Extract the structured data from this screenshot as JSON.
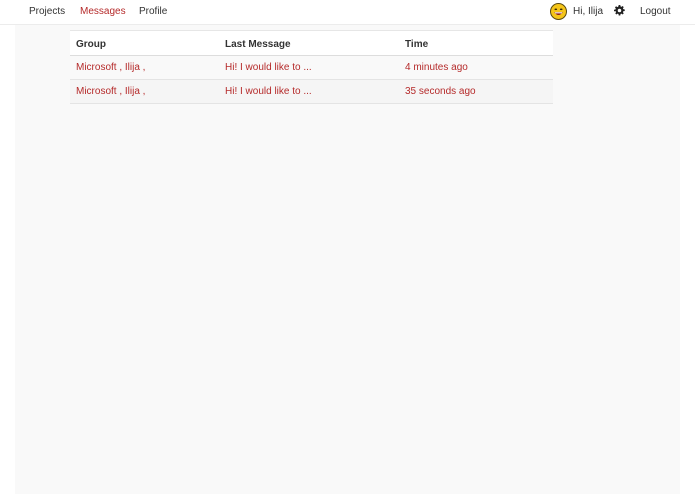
{
  "nav": {
    "items": [
      {
        "label": "Projects",
        "active": false
      },
      {
        "label": "Messages",
        "active": true
      },
      {
        "label": "Profile",
        "active": false
      }
    ]
  },
  "user": {
    "greeting": "Hi, Ilija",
    "avatar_icon": "laughing-face-icon",
    "settings_icon": "gear-icon",
    "logout_label": "Logout"
  },
  "messages_table": {
    "columns": [
      "Group",
      "Last Message",
      "Time"
    ],
    "rows": [
      {
        "group": "Microsoft , Ilija ,",
        "last_message": "Hi! I would like to ...",
        "time": "4 minutes ago"
      },
      {
        "group": "Microsoft , Ilija ,",
        "last_message": "Hi! I would like to ...",
        "time": "35 seconds ago"
      }
    ]
  },
  "colors": {
    "accent": "#b52a2a",
    "text": "#333333",
    "page_background": "#f9f9f9"
  }
}
